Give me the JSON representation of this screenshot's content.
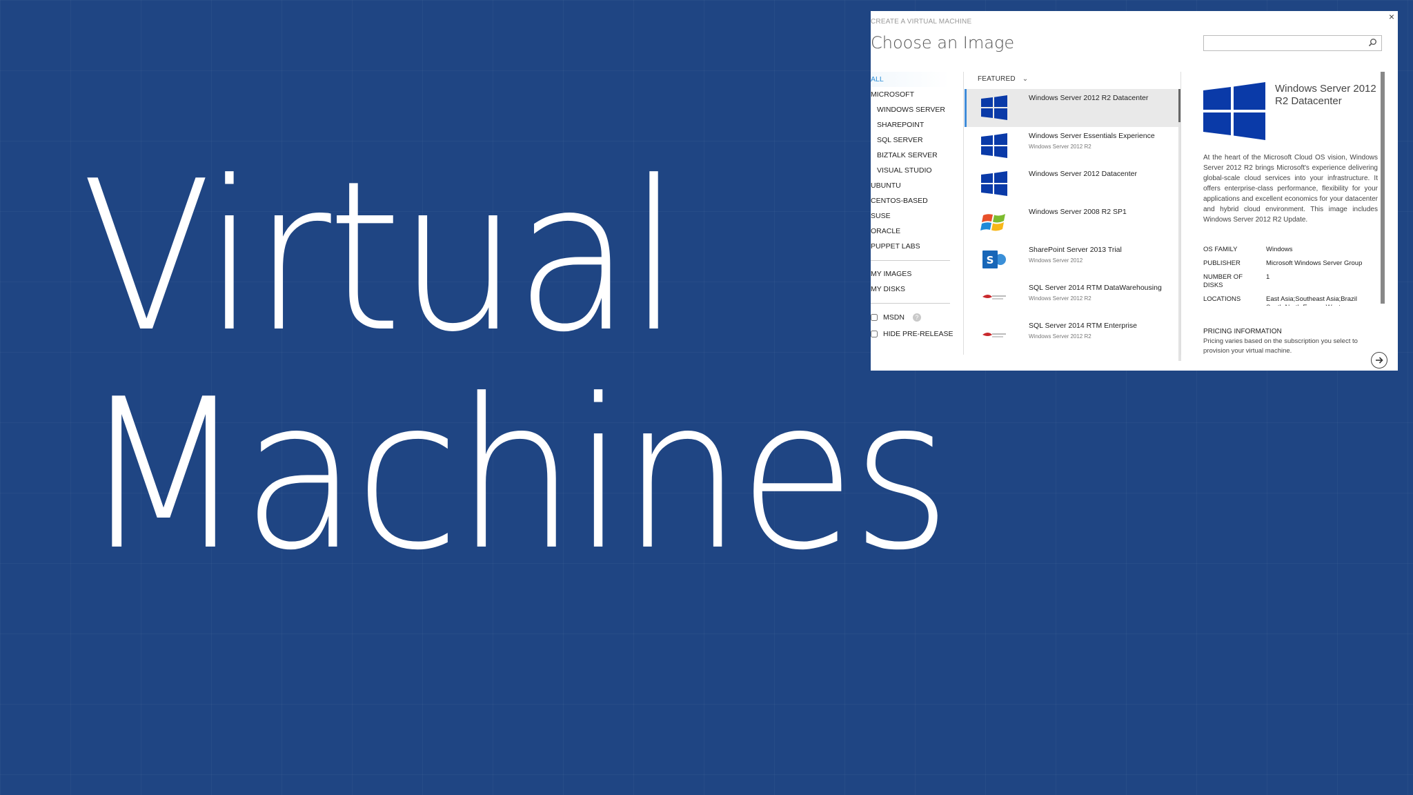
{
  "slide": {
    "title_line1": "Virtual",
    "title_line2": "Machines",
    "background_color": "#1f4583"
  },
  "dialog": {
    "close_label": "×",
    "breadcrumb": "CREATE A VIRTUAL MACHINE",
    "title": "Choose an Image",
    "search": {
      "value": "",
      "placeholder": ""
    },
    "nav": {
      "items": [
        {
          "label": "ALL",
          "active": true
        },
        {
          "label": "MICROSOFT"
        },
        {
          "label": "WINDOWS SERVER",
          "sub": true
        },
        {
          "label": "SHAREPOINT",
          "sub": true
        },
        {
          "label": "SQL SERVER",
          "sub": true
        },
        {
          "label": "BIZTALK SERVER",
          "sub": true
        },
        {
          "label": "VISUAL STUDIO",
          "sub": true
        },
        {
          "label": "UBUNTU"
        },
        {
          "label": "CENTOS-BASED"
        },
        {
          "label": "SUSE"
        },
        {
          "label": "ORACLE"
        },
        {
          "label": "PUPPET LABS"
        }
      ],
      "my_images": "MY IMAGES",
      "my_disks": "MY DISKS",
      "msdn": "MSDN",
      "help_glyph": "?",
      "hide_prerelease": "HIDE PRE-RELEASE"
    },
    "filter": {
      "label": "FEATURED",
      "chevron": "⌄"
    },
    "images": [
      {
        "name": "Windows Server 2012 R2 Datacenter",
        "sub": "",
        "icon": "windows-logo-icon",
        "selected": true
      },
      {
        "name": "Windows Server Essentials Experience",
        "sub": "Windows Server 2012 R2",
        "icon": "windows-logo-icon"
      },
      {
        "name": "Windows Server 2012 Datacenter",
        "sub": "",
        "icon": "windows-logo-icon"
      },
      {
        "name": "Windows Server 2008 R2 SP1",
        "sub": "",
        "icon": "windows-flag-icon"
      },
      {
        "name": "SharePoint Server 2013 Trial",
        "sub": "Windows Server 2012",
        "icon": "sharepoint-icon"
      },
      {
        "name": "SQL Server 2014 RTM DataWarehousing",
        "sub": "Windows Server 2012 R2",
        "icon": "sql-server-icon"
      },
      {
        "name": "SQL Server 2014 RTM Enterprise",
        "sub": "Windows Server 2012 R2",
        "icon": "sql-server-icon"
      }
    ],
    "details": {
      "title": "Windows Server 2012 R2 Datacenter",
      "description": "At the heart of the Microsoft Cloud OS vision, Windows Server 2012 R2 brings Microsoft's experience delivering global-scale cloud services into your infrastructure. It offers enterprise-class performance, flexibility for your applications and excellent economics for your datacenter and hybrid cloud environment. This image includes Windows Server 2012 R2 Update.",
      "props": {
        "os_family_label": "OS FAMILY",
        "os_family": "Windows",
        "publisher_label": "PUBLISHER",
        "publisher": "Microsoft Windows Server Group",
        "disks_label": "NUMBER OF DISKS",
        "disks": "1",
        "locations_label": "LOCATIONS",
        "locations": "East Asia;Southeast Asia;Brazil South;North Europe;West"
      },
      "pricing_header": "PRICING INFORMATION",
      "pricing_text": "Pricing varies based on the subscription you select to provision your virtual machine."
    },
    "next_icon": "arrow-right-icon",
    "colors": {
      "windows_blue": "#0a3aa8",
      "active_nav": "#2f8fd6",
      "selected_bar": "#3f8bd9"
    }
  }
}
